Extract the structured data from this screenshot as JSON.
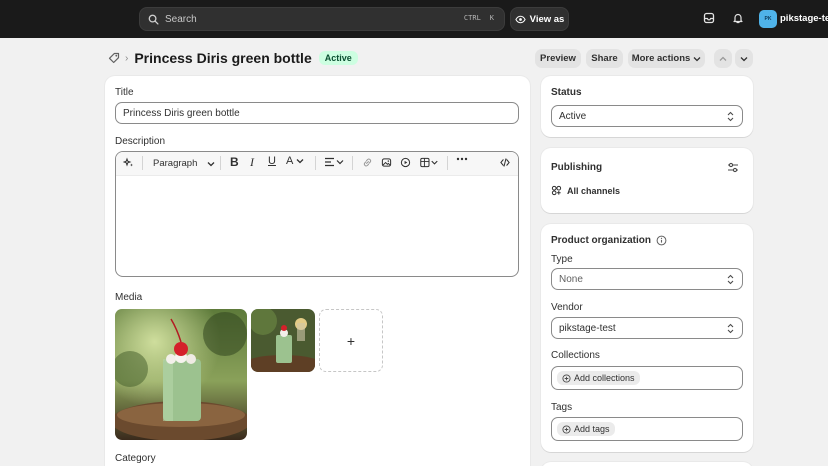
{
  "topbar": {
    "search_placeholder": "Search",
    "shortcut_ctrl": "CTRL",
    "shortcut_key": "K",
    "view_as": "View as",
    "avatar_initials": "PK",
    "store_name": "pikstage-test"
  },
  "header": {
    "title": "Princess Diris green bottle",
    "status_badge": "Active",
    "preview": "Preview",
    "share": "Share",
    "more_actions": "More actions"
  },
  "main": {
    "title_label": "Title",
    "title_value": "Princess Diris green bottle",
    "description_label": "Description",
    "paragraph_select": "Paragraph",
    "media_label": "Media",
    "add_media": "+",
    "category_label": "Category"
  },
  "status_card": {
    "label": "Status",
    "value": "Active"
  },
  "publishing_card": {
    "label": "Publishing",
    "channels": "All channels"
  },
  "organization_card": {
    "label": "Product organization",
    "type_label": "Type",
    "type_value": "None",
    "vendor_label": "Vendor",
    "vendor_value": "pikstage-test",
    "collections_label": "Collections",
    "add_collections": "Add collections",
    "tags_label": "Tags",
    "add_tags": "Add tags"
  },
  "colors": {
    "topbar_bg": "#1a1a1a",
    "badge_bg": "#cdfee1",
    "badge_text": "#0c5132",
    "page_bg": "#f1f1f1"
  }
}
